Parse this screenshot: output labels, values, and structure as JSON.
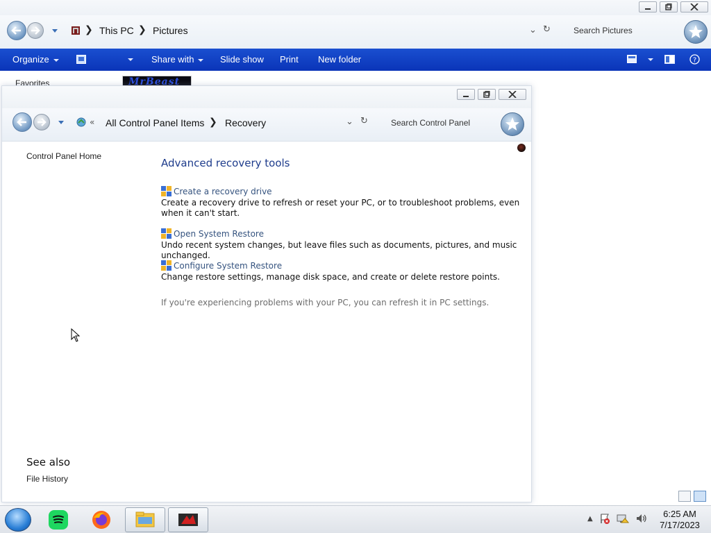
{
  "pictures_window": {
    "breadcrumb": [
      "This PC",
      "Pictures"
    ],
    "search_placeholder": "Search Pictures",
    "toolbar": {
      "organize": "Organize",
      "share_with": "Share with",
      "slide_show": "Slide show",
      "print": "Print",
      "new_folder": "New folder"
    },
    "sidebar": {
      "favorites": "Favorites"
    },
    "thumbnail_text": "MrBeast"
  },
  "control_panel": {
    "breadcrumb": [
      "All Control Panel Items",
      "Recovery"
    ],
    "search_placeholder": "Search Control Panel",
    "sidebar": {
      "home": "Control Panel Home",
      "see_also_heading": "See also",
      "see_also_items": [
        "File History"
      ]
    },
    "heading": "Advanced recovery tools",
    "tasks": [
      {
        "title": "Create a recovery drive",
        "description": "Create a recovery drive to refresh or reset your PC, or to troubleshoot problems, even when it can't start."
      },
      {
        "title": "Open System Restore",
        "description": "Undo recent system changes, but leave files such as documents, pictures, and music unchanged."
      },
      {
        "title": "Configure System Restore",
        "description": "Change restore settings, manage disk space, and create or delete restore points."
      }
    ],
    "footnote": "If you're experiencing problems with your PC, you can refresh it in PC settings."
  },
  "taskbar": {
    "apps": [
      "start-orb",
      "spotify-icon",
      "firefox-icon",
      "file-explorer-icon",
      "mrbeast-app-icon"
    ],
    "clock": {
      "time": "6:25 AM",
      "date": "7/17/2023"
    }
  },
  "colors": {
    "toolbar_blue": "#0a34b8",
    "heading_blue": "#1e3c8c",
    "task_link": "#35537f",
    "footnote_gray": "#6d6d6d"
  }
}
